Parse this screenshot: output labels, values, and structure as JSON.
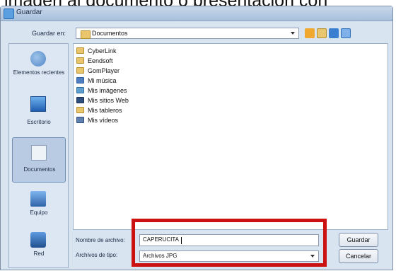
{
  "caption": {
    "text": "imagen al documento o presentación con"
  },
  "dialog": {
    "title": "Guardar",
    "save_in_label": "Guardar en:",
    "save_in_value": "Documentos",
    "places": [
      {
        "label": "Elementos recientes",
        "icon": "recent-items-icon",
        "selected": false
      },
      {
        "label": "Escritorio",
        "icon": "desktop-icon",
        "selected": false
      },
      {
        "label": "Documentos",
        "icon": "documents-icon",
        "selected": true
      },
      {
        "label": "Equipo",
        "icon": "computer-icon",
        "selected": false
      },
      {
        "label": "Red",
        "icon": "network-icon",
        "selected": false
      }
    ],
    "files": [
      {
        "name": "CyberLink",
        "icon": "folder-icon",
        "color": "#e9c66e"
      },
      {
        "name": "Eendsoft",
        "icon": "folder-icon",
        "color": "#e9c66e"
      },
      {
        "name": "GomPlayer",
        "icon": "folder-icon",
        "color": "#e9c66e"
      },
      {
        "name": "Mi música",
        "icon": "music-folder-icon",
        "color": "#4f7fc0"
      },
      {
        "name": "Mis imágenes",
        "icon": "pictures-folder-icon",
        "color": "#5f9fd0"
      },
      {
        "name": "Mis sitios Web",
        "icon": "web-folder-icon",
        "color": "#2f4f7f"
      },
      {
        "name": "Mis tableros",
        "icon": "folder-icon",
        "color": "#e9c66e"
      },
      {
        "name": "Mis vídeos",
        "icon": "video-folder-icon",
        "color": "#5f7faf"
      }
    ],
    "filename_label": "Nombre de archivo:",
    "filename_value": "CAPERUCITA",
    "filetype_label": "Archivos de tipo:",
    "filetype_value": "Archivos JPG",
    "save_button": "Guardar",
    "cancel_button": "Cancelar",
    "highlight_color": "#cc1111"
  }
}
